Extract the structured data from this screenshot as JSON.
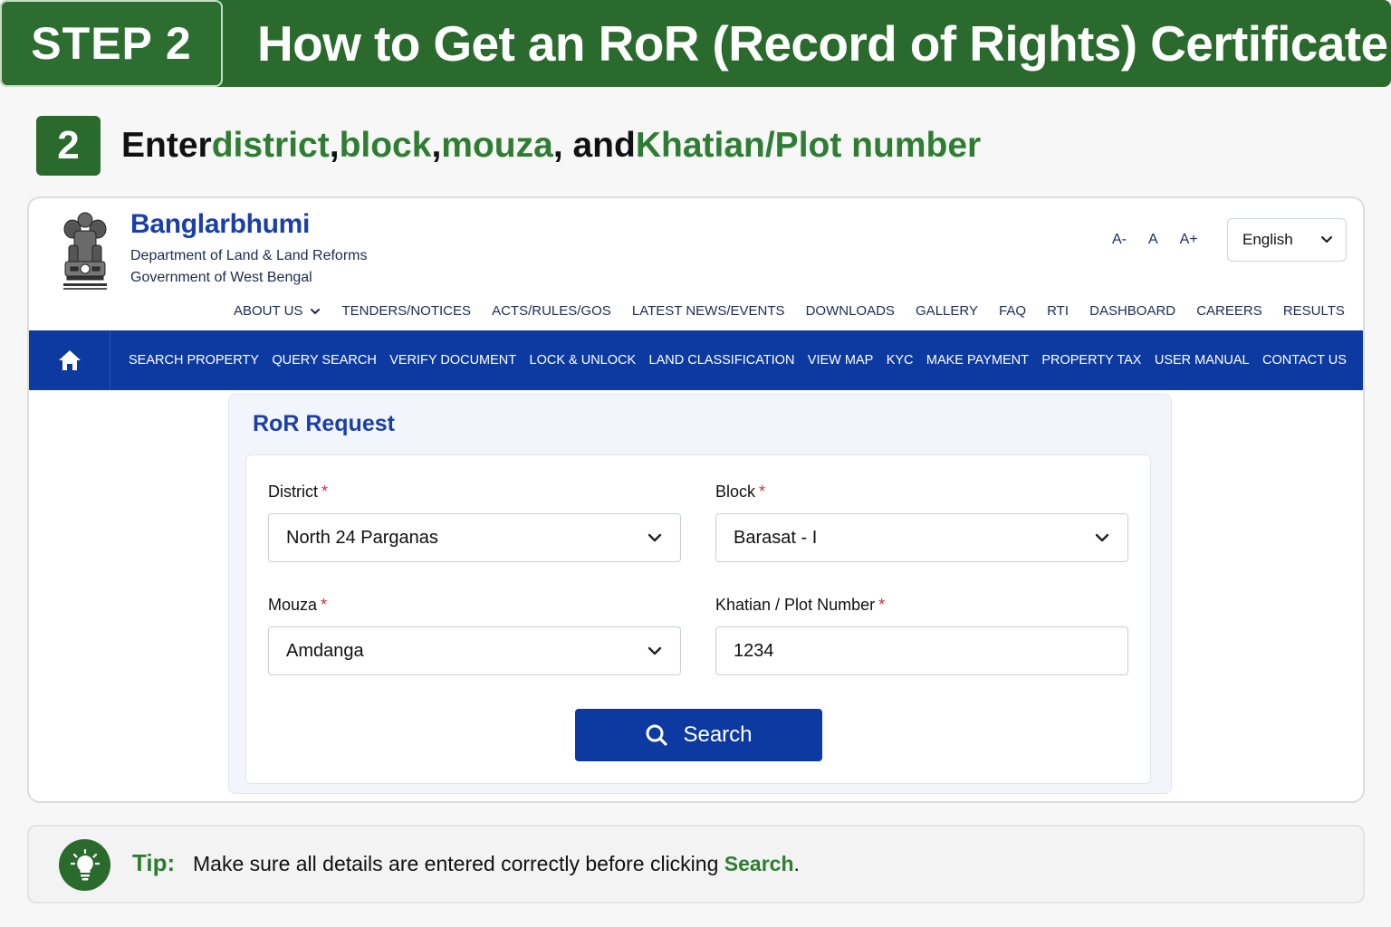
{
  "banner": {
    "step_label": "STEP 2",
    "title": "How to Get an RoR (Record of Rights) Certificate"
  },
  "step": {
    "number": "2",
    "heading_parts": [
      {
        "text": "Enter ",
        "highlight": false
      },
      {
        "text": "district",
        "highlight": true
      },
      {
        "text": ", ",
        "highlight": false
      },
      {
        "text": "block",
        "highlight": true
      },
      {
        "text": ", ",
        "highlight": false
      },
      {
        "text": "mouza",
        "highlight": true
      },
      {
        "text": ", and ",
        "highlight": false
      },
      {
        "text": "Khatian/Plot number",
        "highlight": true
      }
    ]
  },
  "site": {
    "brand": {
      "name": "Banglarbhumi",
      "department": "Department of Land & Land Reforms",
      "government": "Government of West Bengal",
      "emblem_icon": "state-emblem-icon"
    },
    "font_controls": [
      "A-",
      "A",
      "A+"
    ],
    "language": {
      "selected": "English"
    },
    "top_nav": [
      {
        "label": "ABOUT US",
        "dropdown": true
      },
      {
        "label": "TENDERS/NOTICES"
      },
      {
        "label": "ACTS/RULES/GOS"
      },
      {
        "label": "LATEST NEWS/EVENTS"
      },
      {
        "label": "DOWNLOADS"
      },
      {
        "label": "GALLERY"
      },
      {
        "label": "FAQ"
      },
      {
        "label": "RTI"
      },
      {
        "label": "DASHBOARD"
      },
      {
        "label": "CAREERS"
      },
      {
        "label": "RESULTS"
      }
    ],
    "main_nav": [
      "SEARCH PROPERTY",
      "QUERY SEARCH",
      "VERIFY DOCUMENT",
      "LOCK & UNLOCK",
      "LAND CLASSIFICATION",
      "VIEW MAP",
      "KYC",
      "MAKE PAYMENT",
      "PROPERTY TAX",
      "USER MANUAL",
      "CONTACT US"
    ],
    "form": {
      "title": "RoR Request",
      "district": {
        "label": "District",
        "value": "North 24 Parganas"
      },
      "block": {
        "label": "Block",
        "value": "Barasat - I"
      },
      "mouza": {
        "label": "Mouza",
        "value": "Amdanga"
      },
      "khatian": {
        "label": "Khatian / Plot Number",
        "value": "1234"
      },
      "required_mark": "*",
      "search_button": "Search"
    }
  },
  "tip": {
    "label": "Tip:",
    "text_before": "Make sure all details are entered correctly before clicking ",
    "keyword": "Search",
    "text_after": "."
  },
  "colors": {
    "brand_green": "#2a6b2d",
    "highlight_green": "#2e7d32",
    "nav_blue": "#0d3aa0",
    "title_blue": "#1a3fa8",
    "required_red": "#d32f2f"
  }
}
